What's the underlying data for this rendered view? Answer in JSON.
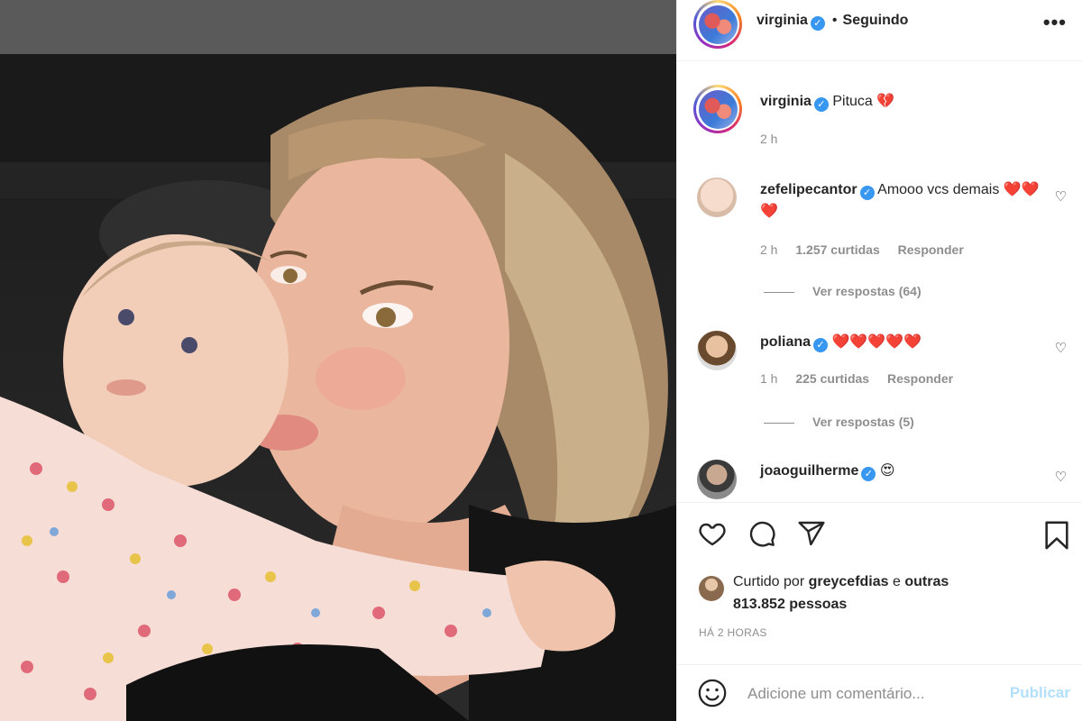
{
  "post": {
    "photo_alt": "",
    "header": {
      "username": "virginia",
      "separator": "•",
      "following_label": "Seguindo",
      "more_label": "•••"
    },
    "caption": {
      "username": "virginia",
      "text": "Pituca 💔",
      "time": "2 h"
    },
    "comments": [
      {
        "username": "zefelipecantor",
        "text": "Amooo vcs demais ❤️❤️❤️",
        "time": "2 h",
        "likes": "1.257 curtidas",
        "reply_label": "Responder",
        "view_replies": "Ver respostas (64)"
      },
      {
        "username": "poliana",
        "text": "❤️❤️❤️❤️❤️",
        "time": "1 h",
        "likes": "225 curtidas",
        "reply_label": "Responder",
        "view_replies": "Ver respostas (5)"
      },
      {
        "username": "joaoguilherme",
        "text": "😍"
      }
    ],
    "likes": {
      "prefix": "Curtido por",
      "user": "greycefdias",
      "suffix": "e",
      "others": "outras 813.852 pessoas"
    },
    "time_ago": "HÁ 2 HORAS",
    "composer": {
      "placeholder": "Adicione um comentário...",
      "publish_label": "Publicar"
    }
  },
  "colors": {
    "link_blue": "#b2dffc",
    "verified_blue": "#3897f0",
    "muted": "#8e8e8e",
    "border": "#efefef"
  }
}
